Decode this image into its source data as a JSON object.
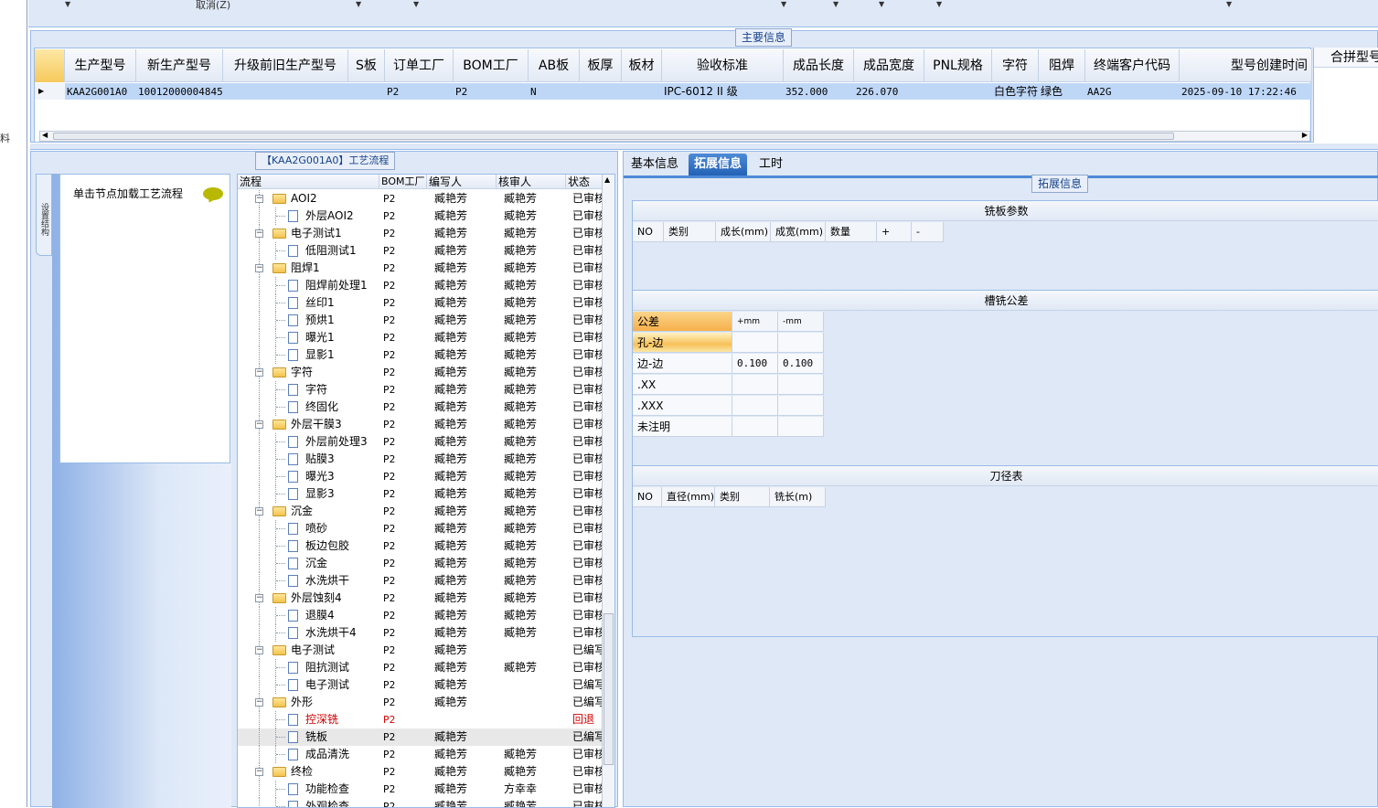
{
  "left_strip_char": "料",
  "toolbar": {
    "cancel_label": "取消(Z)"
  },
  "main": {
    "group_title": "主要信息",
    "columns": [
      "生产型号",
      "新生产型号",
      "升级前旧生产型号",
      "S板",
      "订单工厂",
      "BOM工厂",
      "AB板",
      "板厚",
      "板材",
      "验收标准",
      "成品长度",
      "成品宽度",
      "PNL规格",
      "字符",
      "阻焊",
      "终端客户代码",
      "型号创建时间"
    ],
    "extra_column": "合拼型号",
    "row": [
      "KAA2G001A0",
      "10012000004845",
      "",
      "",
      "P2",
      "P2",
      "N",
      "",
      "",
      "IPC-6012 II 级",
      "352.000",
      "226.070",
      "",
      "白色字符",
      "绿色",
      "AA2G",
      "2025-09-10 17:22:46"
    ]
  },
  "process": {
    "group_title": "【KAA2G001A0】工艺流程",
    "side_tab": "设置结构",
    "load_label": "单击节点加载工艺流程",
    "columns": [
      "流程",
      "BOM工厂",
      "编写人",
      "核审人",
      "状态"
    ],
    "rows": [
      {
        "level": 0,
        "name": "AOI2",
        "bom": "P2",
        "writer": "臧艳芳",
        "reviewer": "臧艳芳",
        "status": "已审核"
      },
      {
        "level": 1,
        "name": "外层AOI2",
        "bom": "P2",
        "writer": "臧艳芳",
        "reviewer": "臧艳芳",
        "status": "已审核"
      },
      {
        "level": 0,
        "name": "电子测试1",
        "bom": "P2",
        "writer": "臧艳芳",
        "reviewer": "臧艳芳",
        "status": "已审核"
      },
      {
        "level": 1,
        "name": "低阻测试1",
        "bom": "P2",
        "writer": "臧艳芳",
        "reviewer": "臧艳芳",
        "status": "已审核"
      },
      {
        "level": 0,
        "name": "阻焊1",
        "bom": "P2",
        "writer": "臧艳芳",
        "reviewer": "臧艳芳",
        "status": "已审核"
      },
      {
        "level": 1,
        "name": "阻焊前处理1",
        "bom": "P2",
        "writer": "臧艳芳",
        "reviewer": "臧艳芳",
        "status": "已审核"
      },
      {
        "level": 1,
        "name": "丝印1",
        "bom": "P2",
        "writer": "臧艳芳",
        "reviewer": "臧艳芳",
        "status": "已审核"
      },
      {
        "level": 1,
        "name": "预烘1",
        "bom": "P2",
        "writer": "臧艳芳",
        "reviewer": "臧艳芳",
        "status": "已审核"
      },
      {
        "level": 1,
        "name": "曝光1",
        "bom": "P2",
        "writer": "臧艳芳",
        "reviewer": "臧艳芳",
        "status": "已审核"
      },
      {
        "level": 1,
        "name": "显影1",
        "bom": "P2",
        "writer": "臧艳芳",
        "reviewer": "臧艳芳",
        "status": "已审核"
      },
      {
        "level": 0,
        "name": "字符",
        "bom": "P2",
        "writer": "臧艳芳",
        "reviewer": "臧艳芳",
        "status": "已审核"
      },
      {
        "level": 1,
        "name": "字符",
        "bom": "P2",
        "writer": "臧艳芳",
        "reviewer": "臧艳芳",
        "status": "已审核"
      },
      {
        "level": 1,
        "name": "终固化",
        "bom": "P2",
        "writer": "臧艳芳",
        "reviewer": "臧艳芳",
        "status": "已审核"
      },
      {
        "level": 0,
        "name": "外层干膜3",
        "bom": "P2",
        "writer": "臧艳芳",
        "reviewer": "臧艳芳",
        "status": "已审核"
      },
      {
        "level": 1,
        "name": "外层前处理3",
        "bom": "P2",
        "writer": "臧艳芳",
        "reviewer": "臧艳芳",
        "status": "已审核"
      },
      {
        "level": 1,
        "name": "贴膜3",
        "bom": "P2",
        "writer": "臧艳芳",
        "reviewer": "臧艳芳",
        "status": "已审核"
      },
      {
        "level": 1,
        "name": "曝光3",
        "bom": "P2",
        "writer": "臧艳芳",
        "reviewer": "臧艳芳",
        "status": "已审核"
      },
      {
        "level": 1,
        "name": "显影3",
        "bom": "P2",
        "writer": "臧艳芳",
        "reviewer": "臧艳芳",
        "status": "已审核"
      },
      {
        "level": 0,
        "name": "沉金",
        "bom": "P2",
        "writer": "臧艳芳",
        "reviewer": "臧艳芳",
        "status": "已审核"
      },
      {
        "level": 1,
        "name": "喷砂",
        "bom": "P2",
        "writer": "臧艳芳",
        "reviewer": "臧艳芳",
        "status": "已审核"
      },
      {
        "level": 1,
        "name": "板边包胶",
        "bom": "P2",
        "writer": "臧艳芳",
        "reviewer": "臧艳芳",
        "status": "已审核"
      },
      {
        "level": 1,
        "name": "沉金",
        "bom": "P2",
        "writer": "臧艳芳",
        "reviewer": "臧艳芳",
        "status": "已审核"
      },
      {
        "level": 1,
        "name": "水洗烘干",
        "bom": "P2",
        "writer": "臧艳芳",
        "reviewer": "臧艳芳",
        "status": "已审核"
      },
      {
        "level": 0,
        "name": "外层蚀刻4",
        "bom": "P2",
        "writer": "臧艳芳",
        "reviewer": "臧艳芳",
        "status": "已审核"
      },
      {
        "level": 1,
        "name": "退膜4",
        "bom": "P2",
        "writer": "臧艳芳",
        "reviewer": "臧艳芳",
        "status": "已审核"
      },
      {
        "level": 1,
        "name": "水洗烘干4",
        "bom": "P2",
        "writer": "臧艳芳",
        "reviewer": "臧艳芳",
        "status": "已审核"
      },
      {
        "level": 0,
        "name": "电子测试",
        "bom": "P2",
        "writer": "臧艳芳",
        "reviewer": "",
        "status": "已编写"
      },
      {
        "level": 1,
        "name": "阻抗测试",
        "bom": "P2",
        "writer": "臧艳芳",
        "reviewer": "臧艳芳",
        "status": "已审核"
      },
      {
        "level": 1,
        "name": "电子测试",
        "bom": "P2",
        "writer": "臧艳芳",
        "reviewer": "",
        "status": "已编写"
      },
      {
        "level": 0,
        "name": "外形",
        "bom": "P2",
        "writer": "臧艳芳",
        "reviewer": "",
        "status": "已编写"
      },
      {
        "level": 1,
        "name": "控深铣",
        "bom": "P2",
        "writer": "",
        "reviewer": "",
        "status": "回退",
        "red": true
      },
      {
        "level": 1,
        "name": "铣板",
        "bom": "P2",
        "writer": "臧艳芳",
        "reviewer": "",
        "status": "已编写",
        "selected": true
      },
      {
        "level": 1,
        "name": "成品清洗",
        "bom": "P2",
        "writer": "臧艳芳",
        "reviewer": "臧艳芳",
        "status": "已审核"
      },
      {
        "level": 0,
        "name": "终检",
        "bom": "P2",
        "writer": "臧艳芳",
        "reviewer": "臧艳芳",
        "status": "已审核"
      },
      {
        "level": 1,
        "name": "功能检查",
        "bom": "P2",
        "writer": "臧艳芳",
        "reviewer": "方幸幸",
        "status": "已审核"
      },
      {
        "level": 1,
        "name": "外观检查",
        "bom": "P2",
        "writer": "臧艳芳",
        "reviewer": "臧艳芳",
        "status": "已审核"
      }
    ]
  },
  "ext": {
    "tabs": [
      "基本信息",
      "拓展信息",
      "工时"
    ],
    "active_tab": 1,
    "group_title": "拓展信息",
    "mill_params": {
      "title": "铣板参数",
      "columns": [
        "NO",
        "类别",
        "成长(mm)",
        "成宽(mm)",
        "数量",
        "+",
        "-"
      ]
    },
    "slot_tol": {
      "title": "槽铣公差",
      "header": [
        "公差",
        "+mm",
        "-mm"
      ],
      "rows": [
        [
          "孔-边",
          "",
          ""
        ],
        [
          "边-边",
          "0.100",
          "0.100"
        ],
        [
          ".XX",
          "",
          ""
        ],
        [
          ".XXX",
          "",
          ""
        ],
        [
          "未注明",
          "",
          ""
        ]
      ]
    },
    "tool_table": {
      "title": "刀径表",
      "columns": [
        "NO",
        "直径(mm)",
        "类别",
        "铣长(m)"
      ]
    }
  }
}
